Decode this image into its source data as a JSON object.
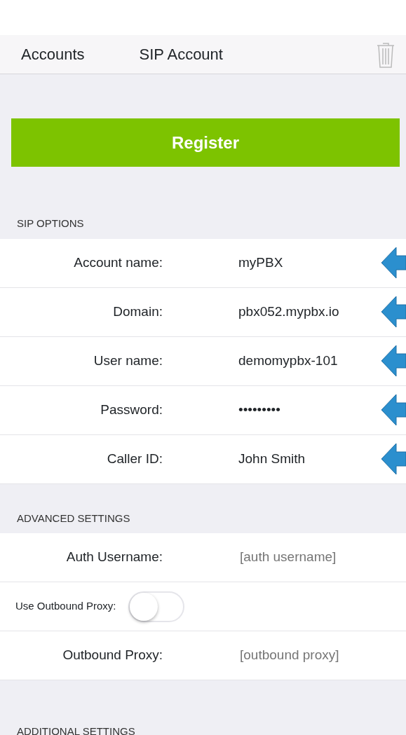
{
  "nav": {
    "back": "Accounts",
    "title": "SIP Account"
  },
  "register_button": "Register",
  "sections": [
    {
      "header": "SIP OPTIONS",
      "rows": [
        {
          "kind": "value",
          "label": "Account name:",
          "value": "myPBX",
          "marked": true
        },
        {
          "kind": "value",
          "label": "Domain:",
          "value": "pbx052.mypbx.io",
          "marked": true
        },
        {
          "kind": "value",
          "label": "User name:",
          "value": "demomypbx-101",
          "marked": true
        },
        {
          "kind": "value",
          "label": "Password:",
          "value": "•••••••••",
          "marked": true
        },
        {
          "kind": "value",
          "label": "Caller ID:",
          "value": "John Smith",
          "marked": true
        }
      ]
    },
    {
      "header": "ADVANCED SETTINGS",
      "rows": [
        {
          "kind": "field",
          "label": "Auth Username:",
          "placeholder": "[auth username]"
        },
        {
          "kind": "switch",
          "label": "Use Outbound Proxy:",
          "on": false
        },
        {
          "kind": "field",
          "label": "Outbound Proxy:",
          "placeholder": "[outbound proxy]"
        }
      ]
    },
    {
      "header": "ADDITIONAL SETTINGS"
    }
  ]
}
